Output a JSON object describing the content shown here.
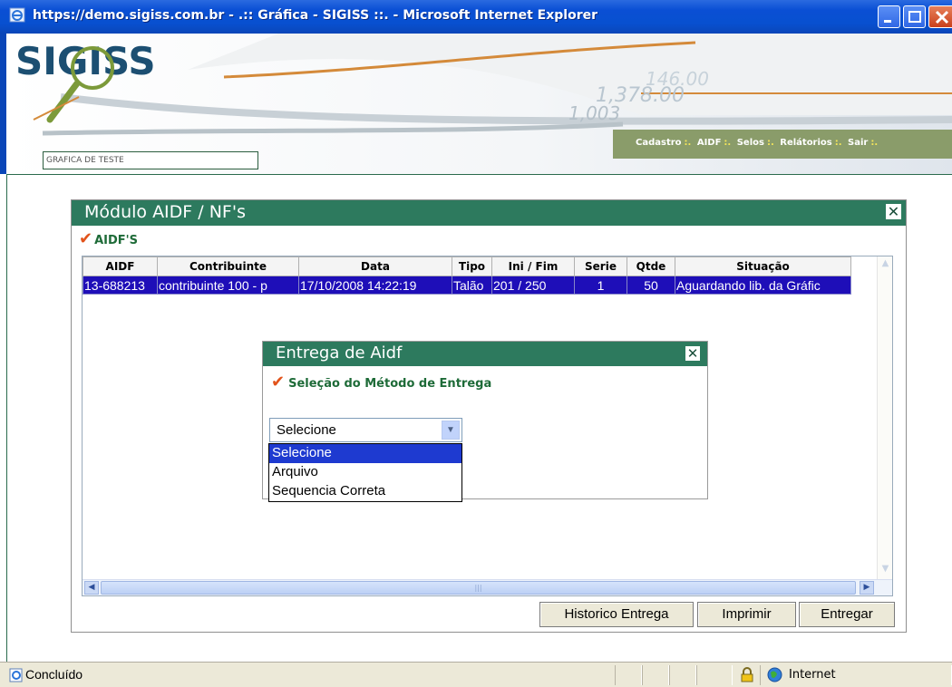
{
  "window": {
    "title": "https://demo.sigiss.com.br - .:: Gráfica - SIGISS ::. - Microsoft Internet Explorer"
  },
  "header": {
    "logo_text": "SIGISS",
    "grafica_name": "GRAFICA DE TESTE",
    "nav": [
      "Cadastro",
      "AIDF",
      "Selos",
      "Relátorios",
      "Sair"
    ]
  },
  "module": {
    "title": "Módulo AIDF / NF's",
    "section_label": "AIDF'S",
    "columns": [
      "AIDF",
      "Contribuinte",
      "Data",
      "Tipo",
      "Ini / Fim",
      "Serie",
      "Qtde",
      "Situação"
    ],
    "rows": [
      {
        "aidf": "13-688213",
        "contribuinte": "contribuinte 100 - p",
        "data": "17/10/2008 14:22:19",
        "tipo": "Talão",
        "ini_fim": "201 / 250",
        "serie": "1",
        "qtde": "50",
        "situacao": "Aguardando lib. da Gráfic"
      }
    ],
    "buttons": {
      "historico": "Historico Entrega",
      "imprimir": "Imprimir",
      "entregar": "Entregar"
    }
  },
  "dialog": {
    "title": "Entrega de Aidf",
    "section_label": "Seleção do Método de Entrega",
    "select_value": "Selecione",
    "options": [
      "Selecione",
      "Arquivo",
      "Sequencia Correta"
    ],
    "selected_index": 0
  },
  "statusbar": {
    "status": "Concluído",
    "zone": "Internet"
  },
  "colors": {
    "titlebar_blue": "#0a4fd4",
    "module_green": "#2d7a5e",
    "selected_row": "#1e0eb8",
    "menu_bg": "#8a9c6a",
    "check_orange": "#e2531b"
  }
}
